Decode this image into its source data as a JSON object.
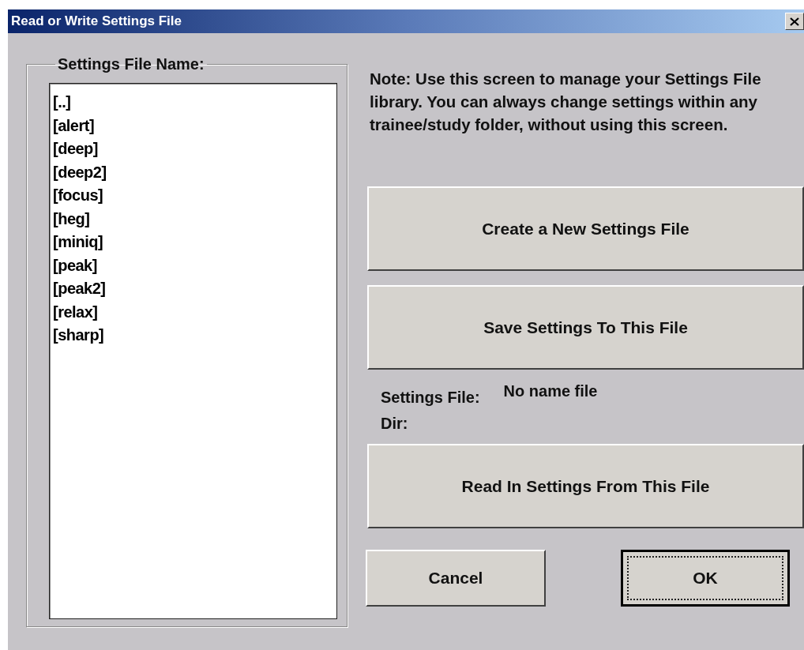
{
  "window": {
    "title": "Read or Write Settings File"
  },
  "file_list": {
    "label": "Settings File Name:",
    "items": [
      {
        "label": "[..]",
        "selected": false
      },
      {
        "label": "[alert]",
        "selected": false
      },
      {
        "label": "[deep]",
        "selected": false
      },
      {
        "label": "[deep2]",
        "selected": false
      },
      {
        "label": "[focus]",
        "selected": false
      },
      {
        "label": "[heg]",
        "selected": false
      },
      {
        "label": "[miniq]",
        "selected": false
      },
      {
        "label": "[peak]",
        "selected": false
      },
      {
        "label": "[peak2]",
        "selected": false
      },
      {
        "label": "[relax]",
        "selected": false
      },
      {
        "label": "[sharp]",
        "selected": false
      }
    ]
  },
  "note": "Note: Use this screen to manage your Settings File library.  You can always change settings within any trainee/study folder, without using this screen.",
  "create_button": "Create a New Settings File",
  "save_button": "Save Settings To This File",
  "settings_file": {
    "label": "Settings File:",
    "value": "No name file"
  },
  "dir": {
    "label": "Dir:"
  },
  "read_button": "Read In Settings From This File",
  "footer_buttons": [
    {
      "label": "Cancel",
      "focused": false
    },
    {
      "label": "OK",
      "focused": true
    }
  ]
}
